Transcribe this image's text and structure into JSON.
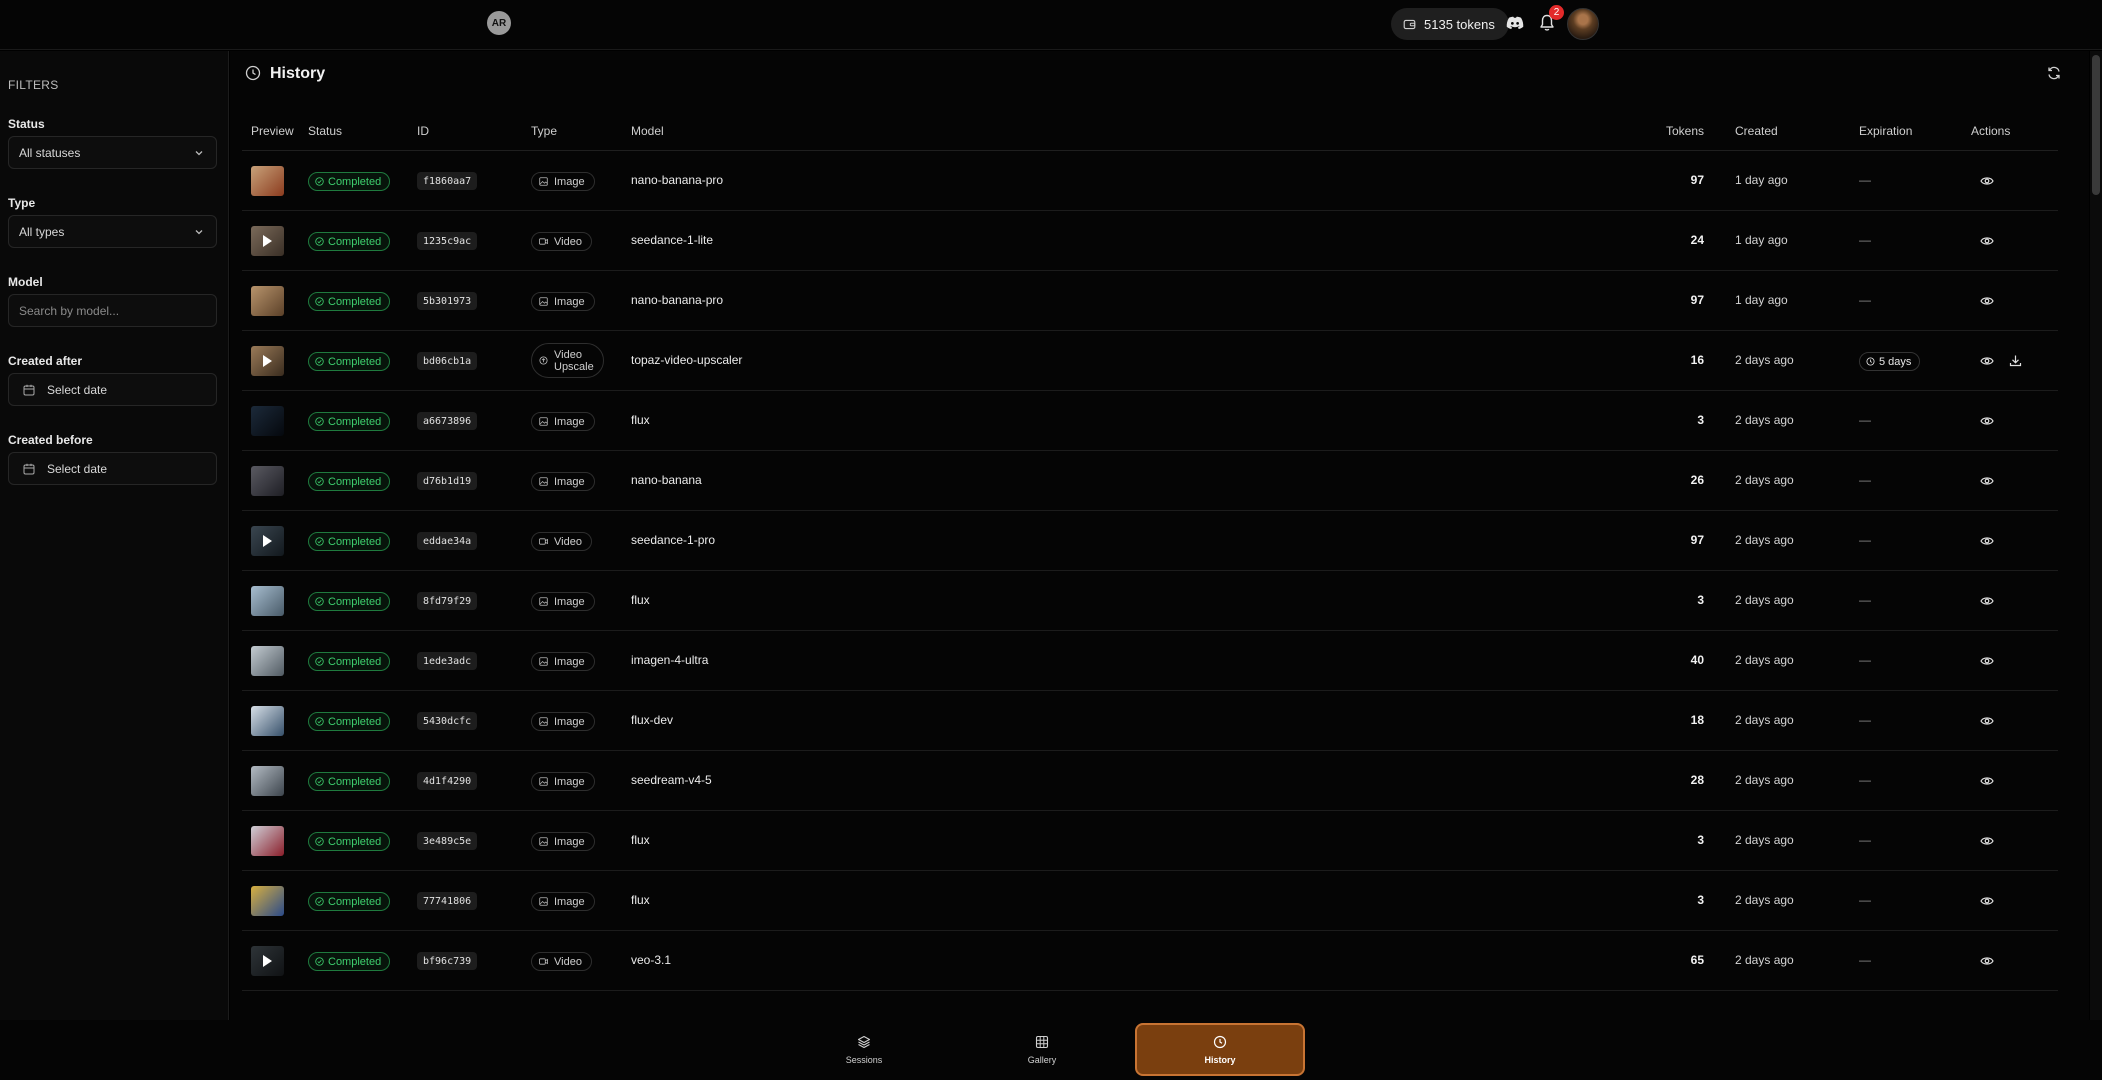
{
  "topbar": {
    "logo_text": "AR",
    "tokens": "5135 tokens",
    "notifications_count": "2"
  },
  "sidebar": {
    "title": "FILTERS",
    "status_label": "Status",
    "status_value": "All statuses",
    "type_label": "Type",
    "type_value": "All types",
    "model_label": "Model",
    "model_placeholder": "Search by model...",
    "created_after_label": "Created after",
    "created_after_value": "Select date",
    "created_before_label": "Created before",
    "created_before_value": "Select date"
  },
  "main": {
    "title": "History",
    "columns": {
      "preview": "Preview",
      "status": "Status",
      "id": "ID",
      "type": "Type",
      "model": "Model",
      "tokens": "Tokens",
      "created": "Created",
      "expiration": "Expiration",
      "actions": "Actions"
    },
    "rows": [
      {
        "thumb": "image",
        "colors": [
          "#c8a27a",
          "#8b3b1e"
        ],
        "status": "Completed",
        "id": "f1860aa7",
        "type": "Image",
        "model": "nano-banana-pro",
        "tokens": "97",
        "created": "1 day ago",
        "expiration": "—"
      },
      {
        "thumb": "video",
        "colors": [
          "#7a6a5a",
          "#3a2f26"
        ],
        "status": "Completed",
        "id": "1235c9ac",
        "type": "Video",
        "model": "seedance-1-lite",
        "tokens": "24",
        "created": "1 day ago",
        "expiration": "—"
      },
      {
        "thumb": "image",
        "colors": [
          "#b8946c",
          "#5b4028"
        ],
        "status": "Completed",
        "id": "5b301973",
        "type": "Image",
        "model": "nano-banana-pro",
        "tokens": "97",
        "created": "1 day ago",
        "expiration": "—"
      },
      {
        "thumb": "video",
        "colors": [
          "#9a7a58",
          "#3a2c1e"
        ],
        "status": "Completed",
        "id": "bd06cb1a",
        "type": "Video Upscale",
        "type_line1": "Video",
        "type_line2": "Upscale",
        "model": "topaz-video-upscaler",
        "tokens": "16",
        "created": "2 days ago",
        "expiration": "5 days",
        "download": true
      },
      {
        "thumb": "image",
        "colors": [
          "#1c2a3a",
          "#05080d"
        ],
        "status": "Completed",
        "id": "a6673896",
        "type": "Image",
        "model": "flux",
        "tokens": "3",
        "created": "2 days ago",
        "expiration": "—"
      },
      {
        "thumb": "image",
        "colors": [
          "#5a5a62",
          "#1e1e24"
        ],
        "status": "Completed",
        "id": "d76b1d19",
        "type": "Image",
        "model": "nano-banana",
        "tokens": "26",
        "created": "2 days ago",
        "expiration": "—"
      },
      {
        "thumb": "video",
        "colors": [
          "#3a4650",
          "#12181d"
        ],
        "status": "Completed",
        "id": "eddae34a",
        "type": "Video",
        "model": "seedance-1-pro",
        "tokens": "97",
        "created": "2 days ago",
        "expiration": "—"
      },
      {
        "thumb": "image",
        "colors": [
          "#a8bed0",
          "#485a68"
        ],
        "status": "Completed",
        "id": "8fd79f29",
        "type": "Image",
        "model": "flux",
        "tokens": "3",
        "created": "2 days ago",
        "expiration": "—"
      },
      {
        "thumb": "image",
        "colors": [
          "#c4ccd2",
          "#505a62"
        ],
        "status": "Completed",
        "id": "1ede3adc",
        "type": "Image",
        "model": "imagen-4-ultra",
        "tokens": "40",
        "created": "2 days ago",
        "expiration": "—"
      },
      {
        "thumb": "image",
        "colors": [
          "#d8e0e8",
          "#36506a"
        ],
        "status": "Completed",
        "id": "5430dcfc",
        "type": "Image",
        "model": "flux-dev",
        "tokens": "18",
        "created": "2 days ago",
        "expiration": "—"
      },
      {
        "thumb": "image",
        "colors": [
          "#b4bcc4",
          "#3c444c"
        ],
        "status": "Completed",
        "id": "4d1f4290",
        "type": "Image",
        "model": "seedream-v4-5",
        "tokens": "28",
        "created": "2 days ago",
        "expiration": "—"
      },
      {
        "thumb": "image",
        "colors": [
          "#d0d0d8",
          "#8a1e2a"
        ],
        "status": "Completed",
        "id": "3e489c5e",
        "type": "Image",
        "model": "flux",
        "tokens": "3",
        "created": "2 days ago",
        "expiration": "—"
      },
      {
        "thumb": "image",
        "colors": [
          "#d8b040",
          "#2a4a8a"
        ],
        "status": "Completed",
        "id": "77741806",
        "type": "Image",
        "model": "flux",
        "tokens": "3",
        "created": "2 days ago",
        "expiration": "—"
      },
      {
        "thumb": "video",
        "colors": [
          "#2e3438",
          "#101214"
        ],
        "status": "Completed",
        "id": "bf96c739",
        "type": "Video",
        "model": "veo-3.1",
        "tokens": "65",
        "created": "2 days ago",
        "expiration": "—"
      }
    ]
  },
  "bottomnav": {
    "sessions": "Sessions",
    "gallery": "Gallery",
    "history": "History"
  },
  "colors": {
    "accent": "#7a3f0f",
    "accent_border": "#c87433",
    "success": "#3ecf6e",
    "badge": "#e32a2a"
  }
}
